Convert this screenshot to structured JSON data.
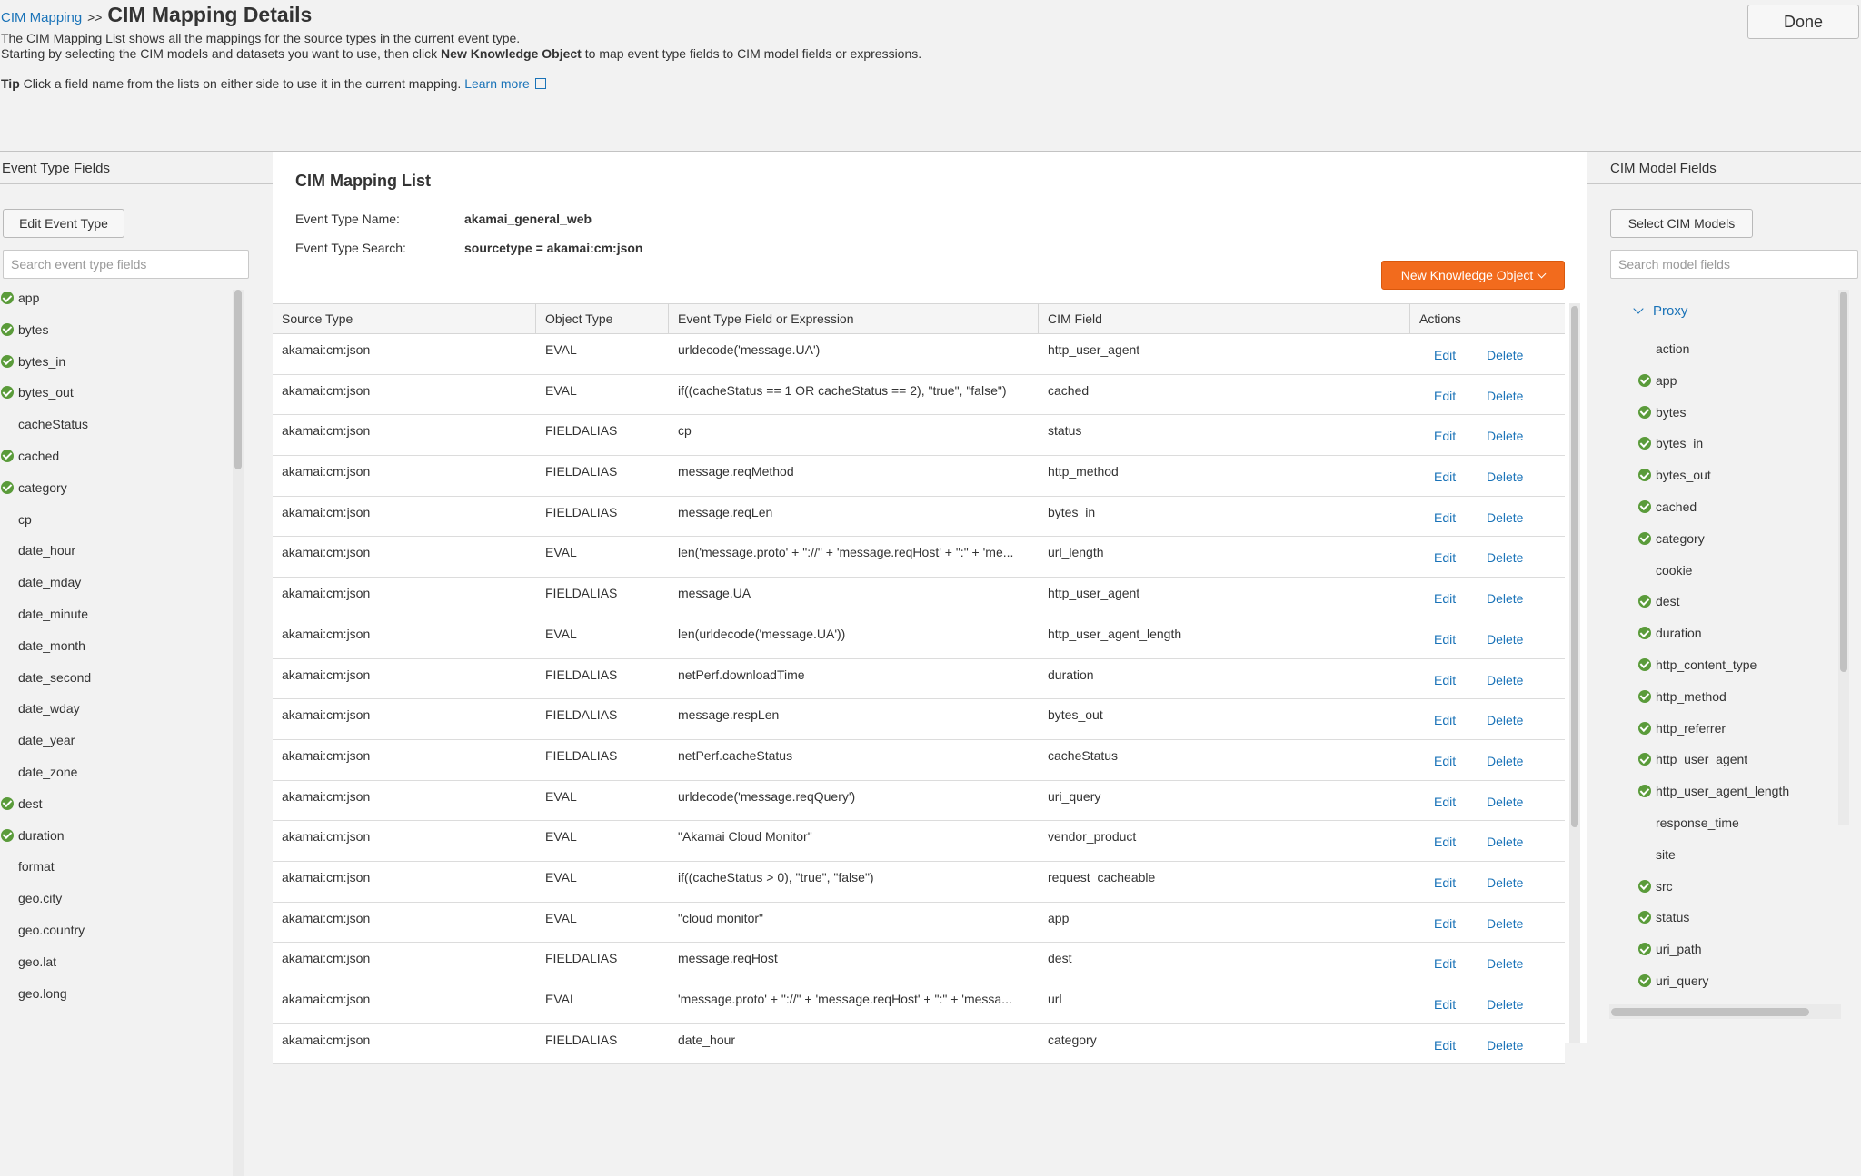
{
  "header": {
    "breadcrumb_link": "CIM Mapping",
    "breadcrumb_sep": ">>",
    "title": "CIM Mapping Details",
    "intro_line1": "The CIM Mapping List shows all the mappings for the source types in the current event type.",
    "intro_line2_pre": "Starting by selecting the CIM models and datasets you want to use, then click ",
    "intro_line2_bold": "New Knowledge Object",
    "intro_line2_post": " to map event type fields to CIM model fields or expressions.",
    "tip_label": "Tip",
    "tip_text": " Click a field name from the lists on either side to use it in the current mapping. ",
    "learn_more": "Learn more",
    "done_label": "Done"
  },
  "left_panel": {
    "title": "Event Type Fields",
    "edit_button": "Edit Event Type",
    "search_placeholder": "Search event type fields",
    "fields": [
      {
        "name": "app",
        "mapped": true
      },
      {
        "name": "bytes",
        "mapped": true
      },
      {
        "name": "bytes_in",
        "mapped": true
      },
      {
        "name": "bytes_out",
        "mapped": true
      },
      {
        "name": "cacheStatus",
        "mapped": false
      },
      {
        "name": "cached",
        "mapped": true
      },
      {
        "name": "category",
        "mapped": true
      },
      {
        "name": "cp",
        "mapped": false
      },
      {
        "name": "date_hour",
        "mapped": false
      },
      {
        "name": "date_mday",
        "mapped": false
      },
      {
        "name": "date_minute",
        "mapped": false
      },
      {
        "name": "date_month",
        "mapped": false
      },
      {
        "name": "date_second",
        "mapped": false
      },
      {
        "name": "date_wday",
        "mapped": false
      },
      {
        "name": "date_year",
        "mapped": false
      },
      {
        "name": "date_zone",
        "mapped": false
      },
      {
        "name": "dest",
        "mapped": true
      },
      {
        "name": "duration",
        "mapped": true
      },
      {
        "name": "format",
        "mapped": false
      },
      {
        "name": "geo.city",
        "mapped": false
      },
      {
        "name": "geo.country",
        "mapped": false
      },
      {
        "name": "geo.lat",
        "mapped": false
      },
      {
        "name": "geo.long",
        "mapped": false
      }
    ]
  },
  "main": {
    "list_title": "CIM Mapping List",
    "event_type_name_label": "Event Type Name:",
    "event_type_name": "akamai_general_web",
    "event_type_search_label": "Event Type Search:",
    "event_type_search": "sourcetype = akamai:cm:json",
    "new_ko_button": "New Knowledge Object",
    "columns": [
      "Source Type",
      "Object Type",
      "Event Type Field or Expression",
      "CIM Field",
      "Actions"
    ],
    "edit_label": "Edit",
    "delete_label": "Delete",
    "rows": [
      {
        "source_type": "akamai:cm:json",
        "object_type": "EVAL",
        "expression": "urldecode('message.UA')",
        "cim_field": "http_user_agent"
      },
      {
        "source_type": "akamai:cm:json",
        "object_type": "EVAL",
        "expression": "if((cacheStatus == 1 OR cacheStatus == 2), \"true\", \"false\")",
        "cim_field": "cached"
      },
      {
        "source_type": "akamai:cm:json",
        "object_type": "FIELDALIAS",
        "expression": "cp",
        "cim_field": "status"
      },
      {
        "source_type": "akamai:cm:json",
        "object_type": "FIELDALIAS",
        "expression": "message.reqMethod",
        "cim_field": "http_method"
      },
      {
        "source_type": "akamai:cm:json",
        "object_type": "FIELDALIAS",
        "expression": "message.reqLen",
        "cim_field": "bytes_in"
      },
      {
        "source_type": "akamai:cm:json",
        "object_type": "EVAL",
        "expression": "len('message.proto' + \"://\" + 'message.reqHost' + \":\" + 'me...",
        "cim_field": "url_length"
      },
      {
        "source_type": "akamai:cm:json",
        "object_type": "FIELDALIAS",
        "expression": "message.UA",
        "cim_field": "http_user_agent"
      },
      {
        "source_type": "akamai:cm:json",
        "object_type": "EVAL",
        "expression": "len(urldecode('message.UA'))",
        "cim_field": "http_user_agent_length"
      },
      {
        "source_type": "akamai:cm:json",
        "object_type": "FIELDALIAS",
        "expression": "netPerf.downloadTime",
        "cim_field": "duration"
      },
      {
        "source_type": "akamai:cm:json",
        "object_type": "FIELDALIAS",
        "expression": "message.respLen",
        "cim_field": "bytes_out"
      },
      {
        "source_type": "akamai:cm:json",
        "object_type": "FIELDALIAS",
        "expression": "netPerf.cacheStatus",
        "cim_field": "cacheStatus"
      },
      {
        "source_type": "akamai:cm:json",
        "object_type": "EVAL",
        "expression": "urldecode('message.reqQuery')",
        "cim_field": "uri_query"
      },
      {
        "source_type": "akamai:cm:json",
        "object_type": "EVAL",
        "expression": "\"Akamai Cloud Monitor\"",
        "cim_field": "vendor_product"
      },
      {
        "source_type": "akamai:cm:json",
        "object_type": "EVAL",
        "expression": "if((cacheStatus > 0), \"true\", \"false\")",
        "cim_field": "request_cacheable"
      },
      {
        "source_type": "akamai:cm:json",
        "object_type": "EVAL",
        "expression": "\"cloud monitor\"",
        "cim_field": "app"
      },
      {
        "source_type": "akamai:cm:json",
        "object_type": "FIELDALIAS",
        "expression": "message.reqHost",
        "cim_field": "dest"
      },
      {
        "source_type": "akamai:cm:json",
        "object_type": "EVAL",
        "expression": "'message.proto' + \"://\" + 'message.reqHost' + \":\" + 'messa...",
        "cim_field": "url"
      },
      {
        "source_type": "akamai:cm:json",
        "object_type": "FIELDALIAS",
        "expression": "date_hour",
        "cim_field": "category"
      }
    ]
  },
  "right_panel": {
    "title": "CIM Model Fields",
    "select_button": "Select CIM Models",
    "search_placeholder": "Search model fields",
    "model_name": "Proxy",
    "fields": [
      {
        "name": "action",
        "mapped": false
      },
      {
        "name": "app",
        "mapped": true
      },
      {
        "name": "bytes",
        "mapped": true
      },
      {
        "name": "bytes_in",
        "mapped": true
      },
      {
        "name": "bytes_out",
        "mapped": true
      },
      {
        "name": "cached",
        "mapped": true
      },
      {
        "name": "category",
        "mapped": true
      },
      {
        "name": "cookie",
        "mapped": false
      },
      {
        "name": "dest",
        "mapped": true
      },
      {
        "name": "duration",
        "mapped": true
      },
      {
        "name": "http_content_type",
        "mapped": true
      },
      {
        "name": "http_method",
        "mapped": true
      },
      {
        "name": "http_referrer",
        "mapped": true
      },
      {
        "name": "http_user_agent",
        "mapped": true
      },
      {
        "name": "http_user_agent_length",
        "mapped": true
      },
      {
        "name": "response_time",
        "mapped": false
      },
      {
        "name": "site",
        "mapped": false
      },
      {
        "name": "src",
        "mapped": true
      },
      {
        "name": "status",
        "mapped": true
      },
      {
        "name": "uri_path",
        "mapped": true
      },
      {
        "name": "uri_query",
        "mapped": true
      }
    ]
  },
  "colors": {
    "accent": "#1a73b8",
    "primary_button": "#f26b1d",
    "check": "#5a9b3a"
  }
}
